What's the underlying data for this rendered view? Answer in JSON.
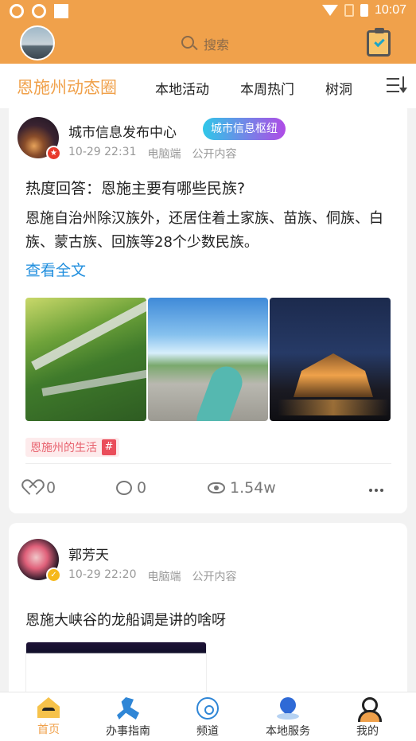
{
  "status_bar": {
    "time": "10:07"
  },
  "header": {
    "search_placeholder": "搜索"
  },
  "tabs": {
    "main": "恩施州动态圈",
    "items": [
      "本地活动",
      "本周热门",
      "树洞"
    ]
  },
  "posts": [
    {
      "author": "城市信息发布中心",
      "tag": "城市信息枢纽",
      "time": "10-29 22:31",
      "device": "电脑端",
      "visibility": "公开内容",
      "title": "热度回答：恩施主要有哪些民族?",
      "body": "恩施自治州除汉族外，还居住着土家族、苗族、侗族、白族、蒙古族、回族等28个少数民族。",
      "read_more": "查看全文",
      "topic": "恩施州的生活",
      "topic_mark": "#",
      "likes": "0",
      "comments": "0",
      "views": "1.54w"
    },
    {
      "author": "郭芳天",
      "time": "10-29 22:20",
      "device": "电脑端",
      "visibility": "公开内容",
      "title": "恩施大峡谷的龙船调是讲的啥呀"
    }
  ],
  "bottom_nav": [
    "首页",
    "办事指南",
    "频道",
    "本地服务",
    "我的"
  ],
  "colors": {
    "accent": "#f0a14b",
    "link": "#1f8ede",
    "tag_gradient_start": "#2fc7e8",
    "tag_gradient_end": "#b04be6"
  }
}
